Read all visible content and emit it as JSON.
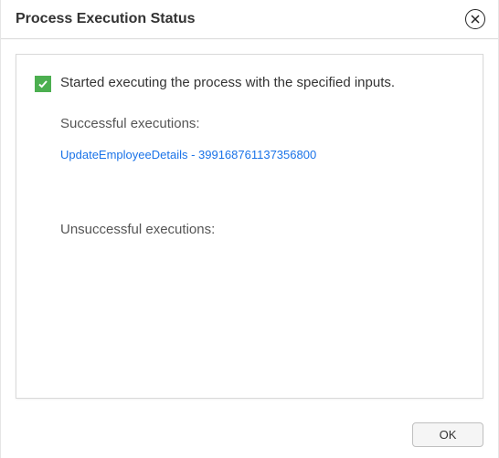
{
  "dialog": {
    "title": "Process Execution Status"
  },
  "status": {
    "message": "Started executing the process with the specified inputs."
  },
  "sections": {
    "successful_label": "Successful executions:",
    "unsuccessful_label": "Unsuccessful executions:"
  },
  "successful_executions": [
    {
      "label": "UpdateEmployeeDetails - 399168761137356800"
    }
  ],
  "footer": {
    "ok_label": "OK"
  }
}
